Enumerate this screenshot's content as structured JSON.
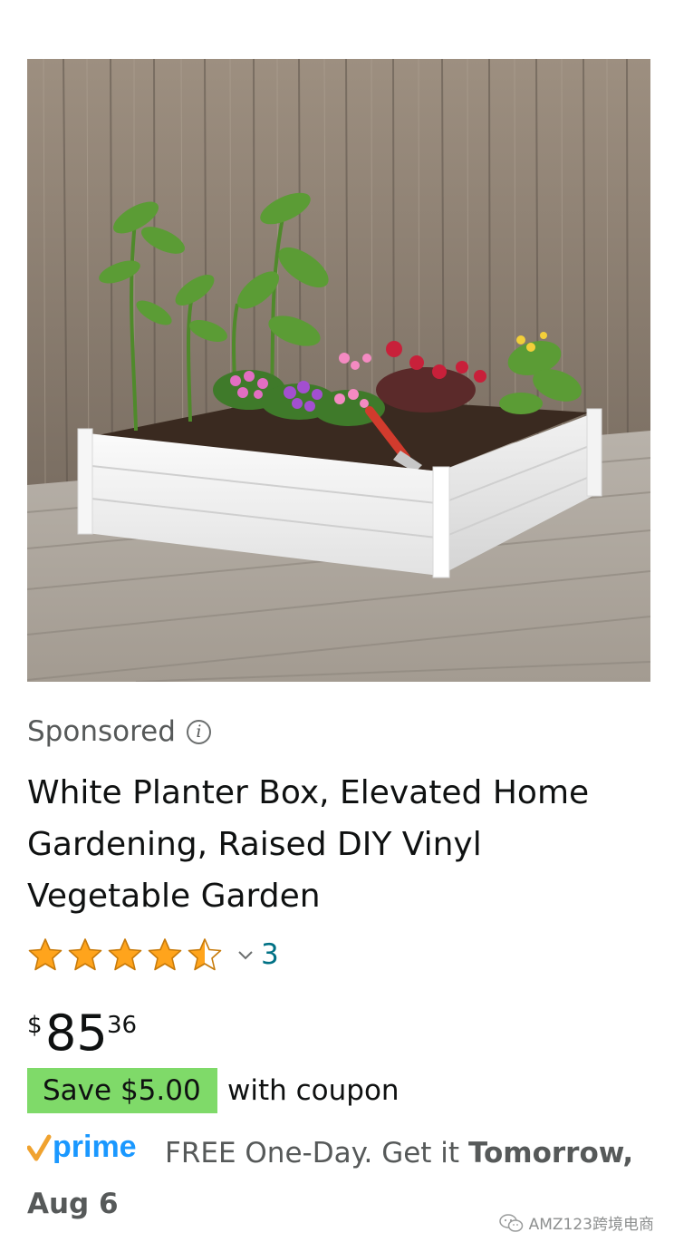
{
  "product": {
    "image_alt": "",
    "sponsored_label": "Sponsored",
    "info_glyph": "i",
    "title": "White Planter Box, Elevated Home Gardening, Raised DIY Vinyl Vegetable Garden",
    "rating": {
      "stars": 4.5,
      "out_of": 5,
      "review_count": "3"
    },
    "price": {
      "symbol": "$",
      "whole": "85",
      "fraction": "36"
    },
    "coupon": {
      "badge": "Save $5.00",
      "text": "with coupon"
    },
    "delivery": {
      "prime_brand": "prime",
      "free_label": "FREE One-Day. Get it ",
      "date_bold": "Tomorrow, Aug 6"
    }
  },
  "watermark": {
    "text": "AMZ123跨境电商",
    "icon": "wechat-icon"
  },
  "colors": {
    "link_teal": "#007185",
    "coupon_green": "#7fda69",
    "star_gold": "#ffa41c",
    "prime_blue": "#1a98ff",
    "prime_orange": "#f0a22e",
    "muted_text": "#565959"
  },
  "icons": {
    "info": "info-icon",
    "star": "star-icon",
    "chevron": "chevron-down-icon",
    "prime": "prime-logo"
  }
}
